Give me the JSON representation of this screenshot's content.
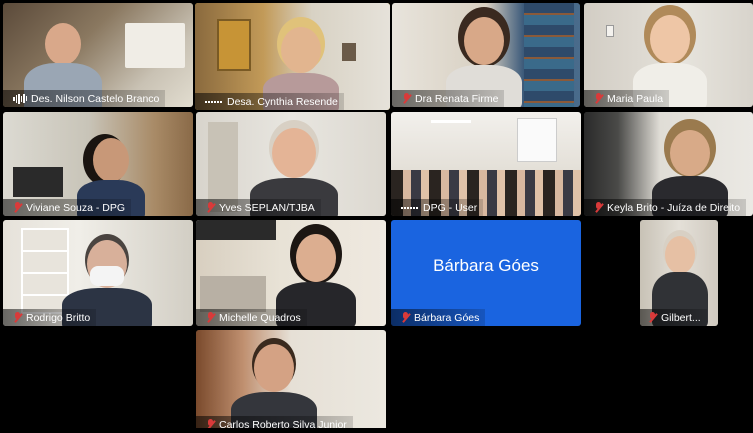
{
  "meeting": {
    "participants": [
      {
        "name": "Des. Nilson Castelo Branco",
        "audio": "speaking"
      },
      {
        "name": "Desa. Cynthia Resende",
        "audio": "active",
        "active_speaker": true
      },
      {
        "name": "Dra Renata Firme",
        "audio": "muted"
      },
      {
        "name": "Maria Paula",
        "audio": "muted"
      },
      {
        "name": "Viviane Souza - DPG",
        "audio": "muted"
      },
      {
        "name": "Yves SEPLAN/TJBA",
        "audio": "muted"
      },
      {
        "name": "DPG - User",
        "audio": "active"
      },
      {
        "name": "Keyla Brito - Juíza de Direito",
        "audio": "muted"
      },
      {
        "name": "Rodrigo Britto",
        "audio": "muted"
      },
      {
        "name": "Michelle Quadros",
        "audio": "muted"
      },
      {
        "name": "Bárbara Góes",
        "audio": "muted",
        "video_off": true
      },
      {
        "name": "Gilbert...",
        "audio": "muted"
      },
      {
        "name": "Carlos Roberto Silva Junior",
        "audio": "muted"
      }
    ]
  },
  "colors": {
    "active_speaker_border": "#e8b418",
    "avatar_background": "#1a64e0",
    "muted_icon": "#d93a3a"
  }
}
